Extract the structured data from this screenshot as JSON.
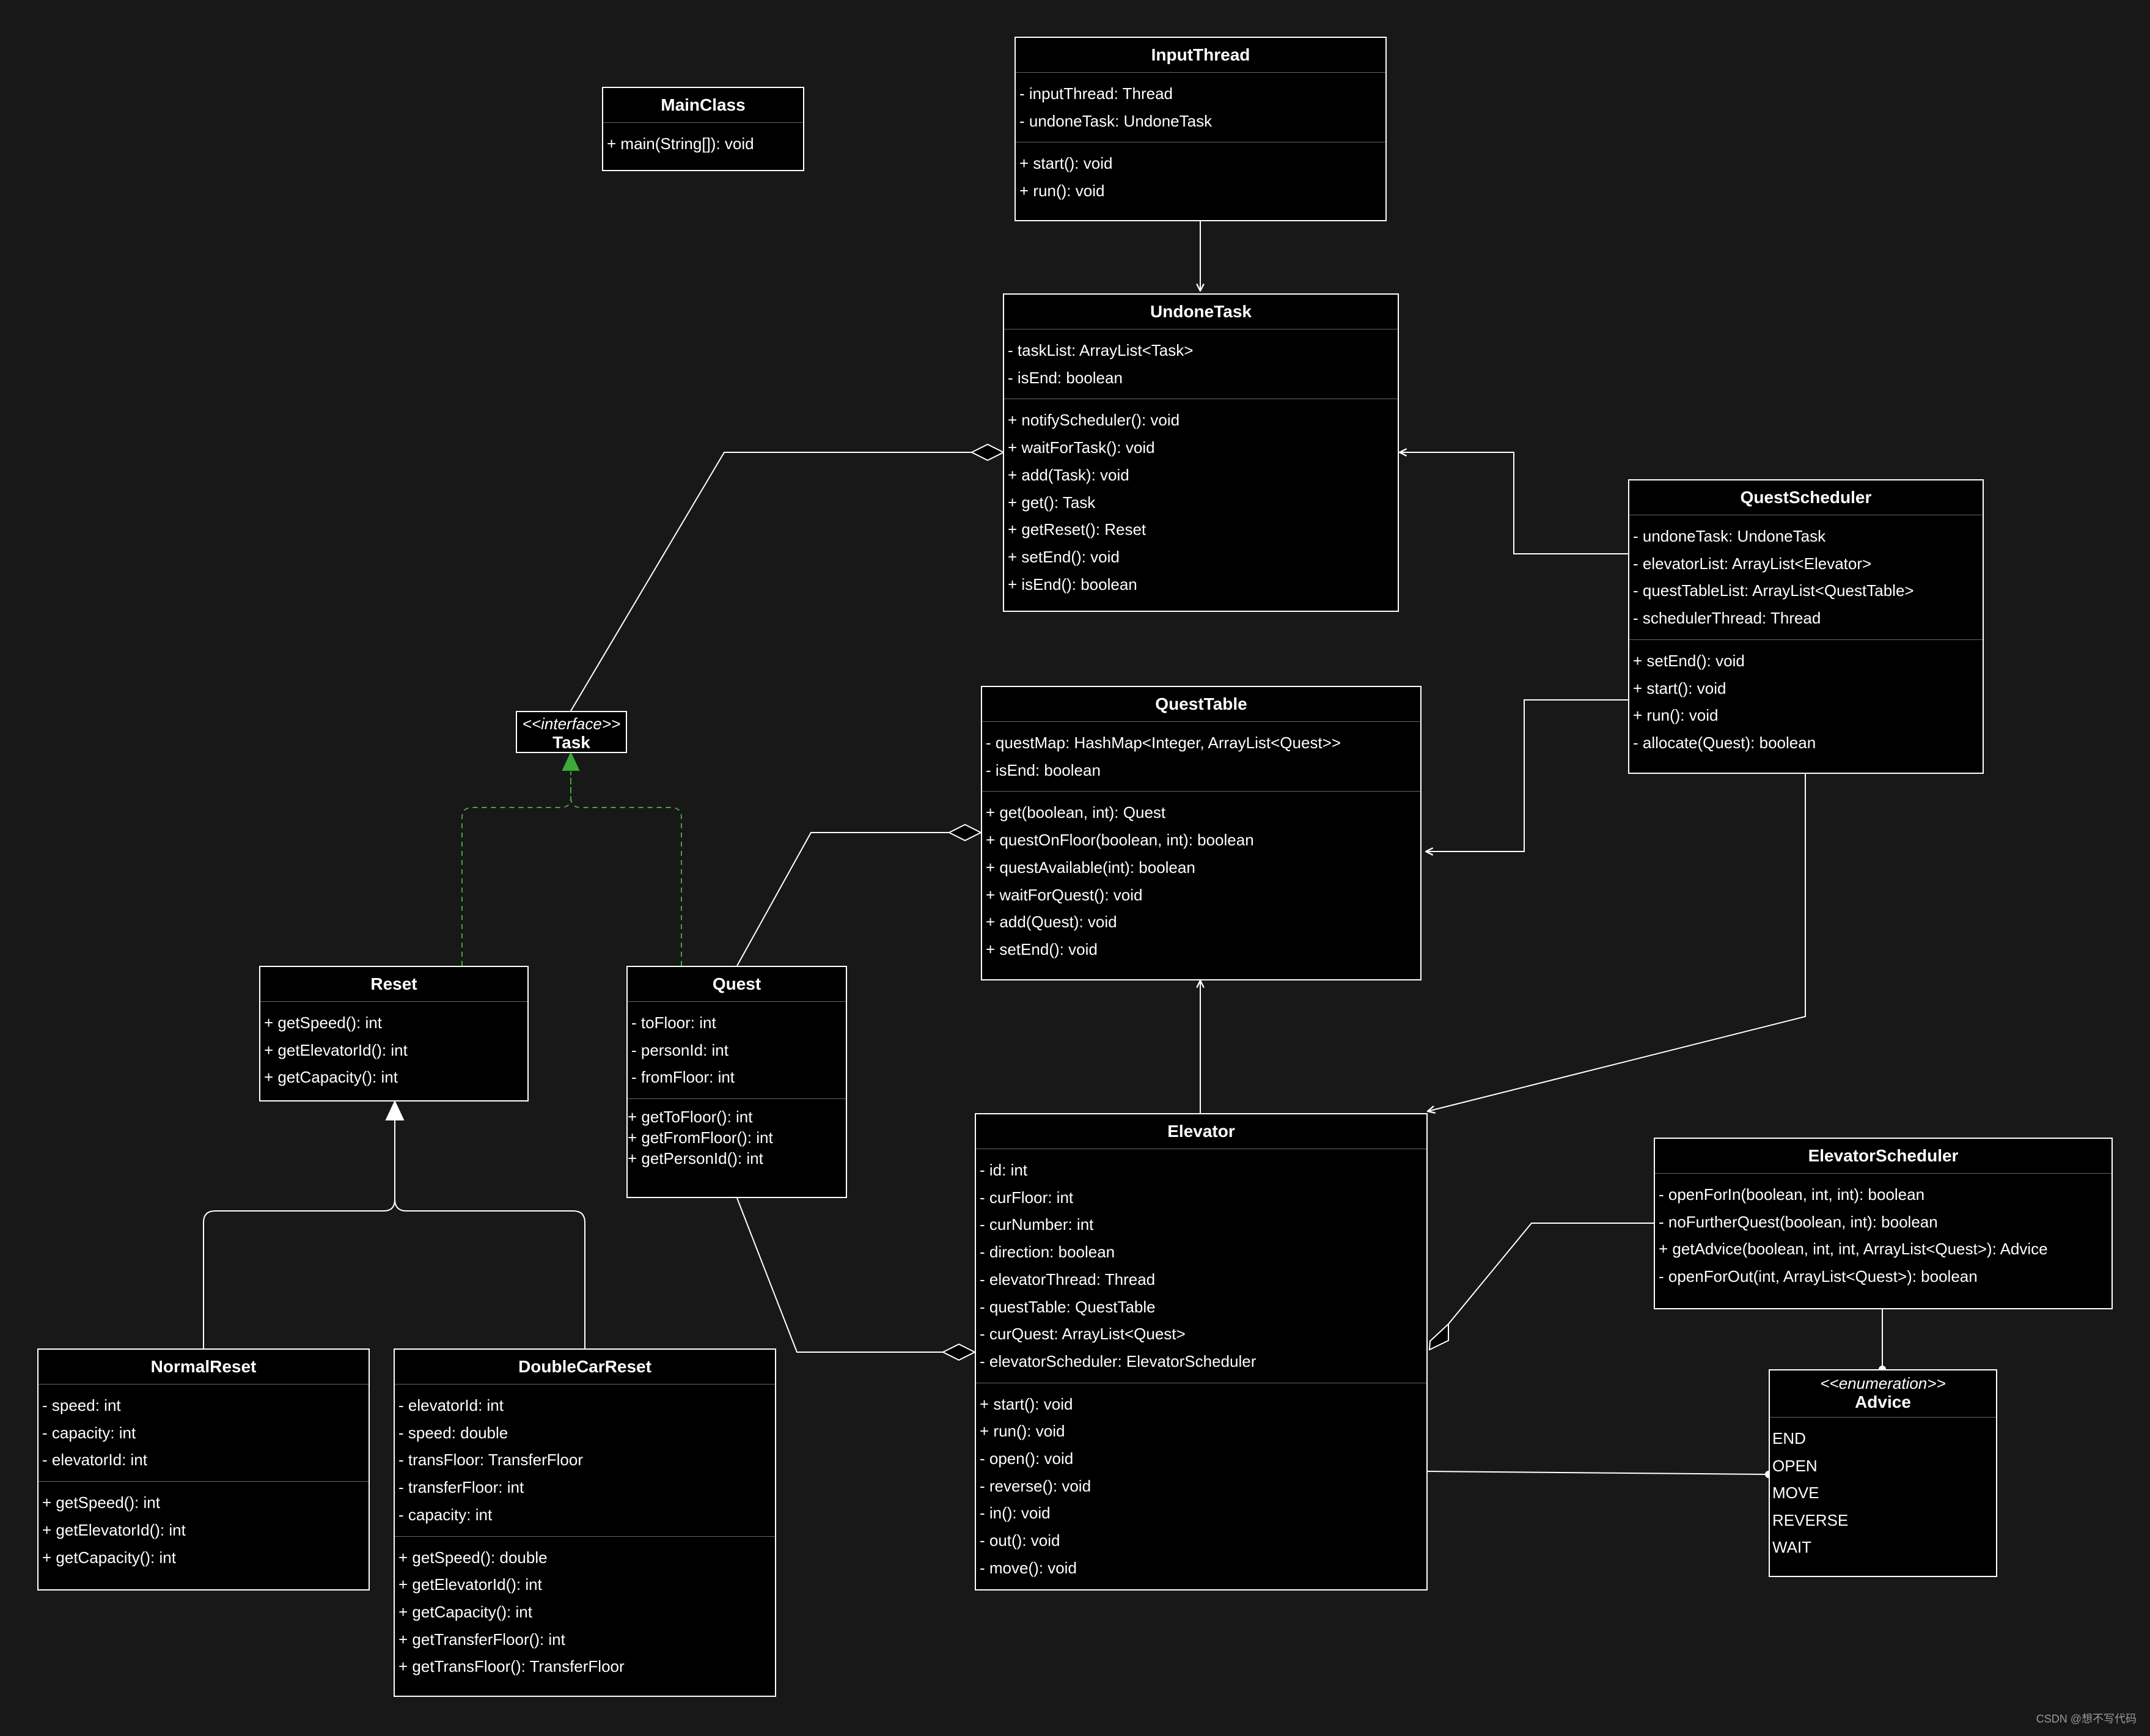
{
  "watermark": "CSDN @想不写代码",
  "colors": {
    "background": "#181818",
    "box_fill": "#000000",
    "line": "#ffffff",
    "realization": "#3aab3a"
  },
  "classes": {
    "main_class": {
      "name": "MainClass",
      "methods": [
        "+ main(String[]): void"
      ]
    },
    "input_thread": {
      "name": "InputThread",
      "fields": [
        "- inputThread: Thread",
        "- undoneTask: UndoneTask"
      ],
      "methods": [
        "+ start(): void",
        "+ run(): void"
      ]
    },
    "undone_task": {
      "name": "UndoneTask",
      "fields": [
        "- taskList: ArrayList<Task>",
        "- isEnd: boolean"
      ],
      "methods": [
        "+ notifyScheduler(): void",
        "+ waitForTask(): void",
        "+ add(Task): void",
        "+ get(): Task",
        "+ getReset(): Reset",
        "+ setEnd(): void",
        "+ isEnd(): boolean"
      ]
    },
    "quest_scheduler": {
      "name": "QuestScheduler",
      "fields": [
        "- undoneTask: UndoneTask",
        "- elevatorList: ArrayList<Elevator>",
        "- questTableList: ArrayList<QuestTable>",
        "- schedulerThread: Thread"
      ],
      "methods": [
        "+ setEnd(): void",
        "+ start(): void",
        "+ run(): void",
        "- allocate(Quest): boolean"
      ]
    },
    "task": {
      "stereotype": "<<interface>>",
      "name": "Task"
    },
    "quest_table": {
      "name": "QuestTable",
      "fields": [
        "- questMap: HashMap<Integer, ArrayList<Quest>>",
        "- isEnd: boolean"
      ],
      "methods": [
        "+ get(boolean, int): Quest",
        "+ questOnFloor(boolean, int): boolean",
        "+ questAvailable(int): boolean",
        "+ waitForQuest(): void",
        "+ add(Quest): void",
        "+ setEnd(): void"
      ]
    },
    "reset": {
      "name": "Reset",
      "methods": [
        "+ getSpeed(): int",
        "+ getElevatorId(): int",
        "+ getCapacity(): int"
      ]
    },
    "quest": {
      "name": "Quest",
      "fields": [
        "- toFloor: int",
        "- personId: int",
        "- fromFloor: int"
      ],
      "methods": [
        "+ getToFloor(): int",
        "+ getFromFloor(): int",
        "+ getPersonId(): int"
      ]
    },
    "elevator": {
      "name": "Elevator",
      "fields": [
        "- id: int",
        "- curFloor: int",
        "- curNumber: int",
        "- direction: boolean",
        "- elevatorThread: Thread",
        "- questTable: QuestTable",
        "- curQuest: ArrayList<Quest>",
        "- elevatorScheduler: ElevatorScheduler"
      ],
      "methods": [
        "+ start(): void",
        "+ run(): void",
        "- open(): void",
        "- reverse(): void",
        "- in(): void",
        "- out(): void",
        "- move(): void"
      ]
    },
    "elevator_scheduler": {
      "name": "ElevatorScheduler",
      "methods": [
        "- openForIn(boolean, int, int): boolean",
        "- noFurtherQuest(boolean, int): boolean",
        "+ getAdvice(boolean, int, int, ArrayList<Quest>): Advice",
        "- openForOut(int, ArrayList<Quest>): boolean"
      ]
    },
    "advice": {
      "stereotype": "<<enumeration>>",
      "name": "Advice",
      "values": [
        "END",
        "OPEN",
        "MOVE",
        "REVERSE",
        "WAIT"
      ]
    },
    "normal_reset": {
      "name": "NormalReset",
      "fields": [
        "- speed: int",
        "- capacity: int",
        "- elevatorId: int"
      ],
      "methods": [
        "+ getSpeed(): int",
        "+ getElevatorId(): int",
        "+ getCapacity(): int"
      ]
    },
    "double_car_reset": {
      "name": "DoubleCarReset",
      "fields": [
        "- elevatorId: int",
        "- speed: double",
        "- transFloor: TransferFloor",
        "- transferFloor: int",
        "- capacity: int"
      ],
      "methods": [
        "+ getSpeed(): double",
        "+ getElevatorId(): int",
        "+ getCapacity(): int",
        "+ getTransferFloor(): int",
        "+ getTransFloor(): TransferFloor"
      ]
    }
  }
}
